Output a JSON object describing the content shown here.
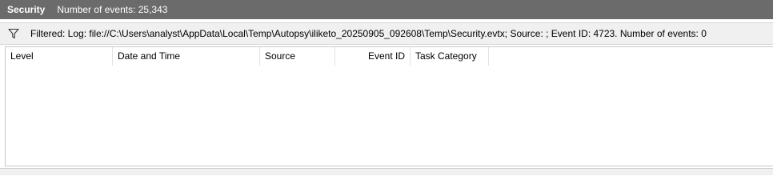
{
  "header": {
    "title": "Security",
    "event_count": "Number of events: 25,343"
  },
  "filter": {
    "icon": "filter-icon",
    "text": "Filtered: Log: file://C:\\Users\\analyst\\AppData\\Local\\Temp\\Autopsy\\iliketo_20250905_092608\\Temp\\Security.evtx; Source: ; Event ID: 4723. Number of events: 0"
  },
  "columns": [
    "Level",
    "Date and Time",
    "Source",
    "Event ID",
    "Task Category"
  ],
  "rows": []
}
